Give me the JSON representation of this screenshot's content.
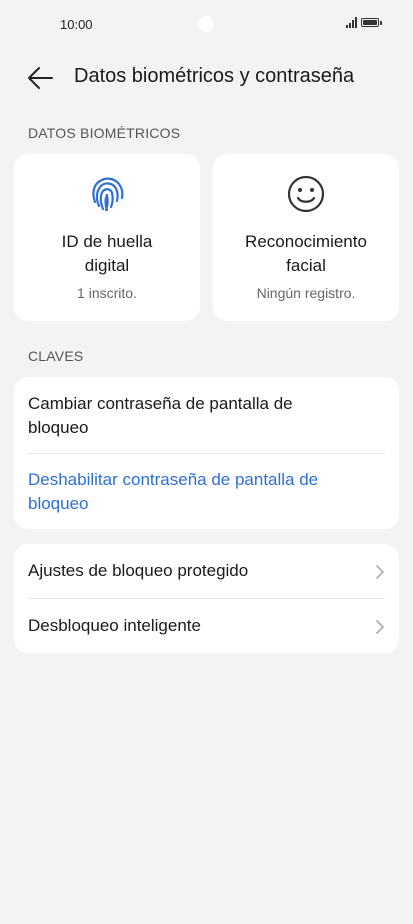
{
  "status_bar": {
    "time": "10:00"
  },
  "header": {
    "title": "Datos biométricos y contraseña"
  },
  "biometrics": {
    "section_label": "DATOS BIOMÉTRICOS",
    "fingerprint": {
      "title_line1": "ID de huella",
      "title_line2": "digital",
      "subtitle": "1 inscrito.",
      "icon": "fingerprint-icon"
    },
    "face": {
      "title_line1": "Reconocimiento",
      "title_line2": "facial",
      "subtitle": "Ningún registro.",
      "icon": "face-icon"
    }
  },
  "keys": {
    "section_label": "CLAVES",
    "change_line1": "Cambiar contraseña de pantalla de",
    "change_line2": "bloqueo",
    "disable_line1": "Deshabilitar contraseña de pantalla de",
    "disable_line2": "bloqueo"
  },
  "more": {
    "protected_lock": "Ajustes de bloqueo protegido",
    "smart_unlock": "Desbloqueo inteligente"
  },
  "colors": {
    "accent": "#2f6fd6",
    "background": "#f1f3f5",
    "card": "#ffffff"
  }
}
